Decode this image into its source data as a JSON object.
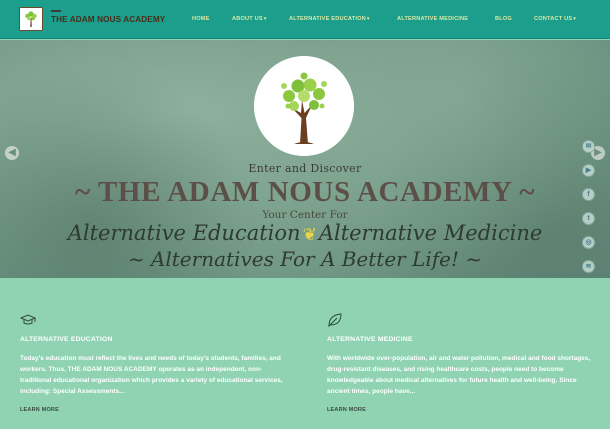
{
  "header": {
    "site_title": "THE ADAM NOUS ACADEMY",
    "logo_icon": "tree-logo-icon",
    "nav": [
      {
        "label": "HOME",
        "has_dropdown": false
      },
      {
        "label": "ABOUT US",
        "has_dropdown": true
      },
      {
        "label": "ALTERNATIVE EDUCATION",
        "has_dropdown": true
      },
      {
        "label": "ALTERNATIVE MEDICINE",
        "has_dropdown": false
      },
      {
        "label": "BLOG",
        "has_dropdown": false
      },
      {
        "label": "CONTACT US",
        "has_dropdown": true
      }
    ],
    "dropdown_caret": "▾"
  },
  "hero": {
    "enter_text": "Enter and Discover",
    "title": "~ THE ADAM NOUS ACADEMY ~",
    "subtitle": "Your Center For",
    "script_left": "Alternative Education",
    "script_right": "Alternative Medicine",
    "script_line2": "~ Alternatives For A Better Life! ~",
    "prev_icon": "arrow-left-icon",
    "next_icon": "arrow-right-icon",
    "social_icons": [
      "email-icon",
      "youtube-icon",
      "facebook-icon",
      "twitter-icon",
      "instagram-icon",
      "rss-icon"
    ]
  },
  "features": [
    {
      "icon": "graduation-cap-icon",
      "title": "ALTERNATIVE EDUCATION",
      "text": "Today's education must reflect the lives and needs of today's students, families, and workers. Thus, THE ADAM NOUS ACADEMY operates as an independent, non-traditional educational organization which provides a variety of educational services, including: Special Assessments...",
      "link": "LEARN MORE"
    },
    {
      "icon": "leaf-icon",
      "title": "ALTERNATIVE MEDICINE",
      "text": "With worldwide over-population, air and water pollution, medical and food shortages, drug-resistant diseases, and rising healthcare costs, people need to become knowledgeable about medical alternatives for future health and well-being.  Since ancient times, people have...",
      "link": "LEARN MORE"
    }
  ],
  "colors": {
    "header_bg": "#1b9e8c",
    "nav_text": "#d9e9a6",
    "feature_bg": "#8fd3b2",
    "title_text": "#5b4f48"
  }
}
